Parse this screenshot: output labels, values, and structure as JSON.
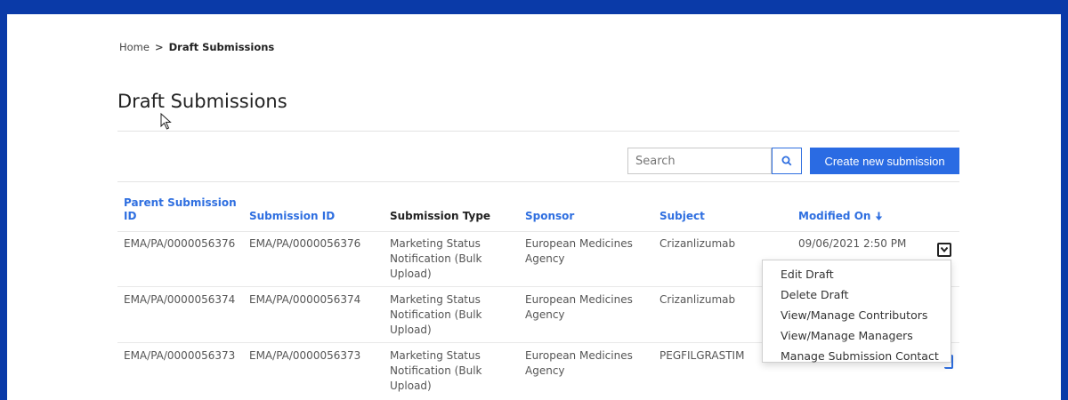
{
  "breadcrumb": {
    "home": "Home",
    "separator": ">",
    "current": "Draft Submissions"
  },
  "page": {
    "title": "Draft Submissions"
  },
  "toolbar": {
    "search_placeholder": "Search",
    "search_icon": "search-icon",
    "create_label": "Create new submission"
  },
  "table": {
    "headers": {
      "parent_id": "Parent Submission ID",
      "submission_id": "Submission ID",
      "type": "Submission Type",
      "sponsor": "Sponsor",
      "subject": "Subject",
      "modified": "Modified On"
    },
    "sort_icon": "arrow-down-icon",
    "rows": [
      {
        "parent_id": "EMA/PA/0000056376",
        "submission_id": "EMA/PA/0000056376",
        "type": "Marketing Status Notification (Bulk Upload)",
        "sponsor": "European Medicines Agency",
        "subject": "Crizanlizumab",
        "modified": "09/06/2021 2:50 PM"
      },
      {
        "parent_id": "EMA/PA/0000056374",
        "submission_id": "EMA/PA/0000056374",
        "type": "Marketing Status Notification (Bulk Upload)",
        "sponsor": "European Medicines Agency",
        "subject": "Crizanlizumab",
        "modified": ""
      },
      {
        "parent_id": "EMA/PA/0000056373",
        "submission_id": "EMA/PA/0000056373",
        "type": "Marketing Status Notification (Bulk Upload)",
        "sponsor": "European Medicines Agency",
        "subject": "PEGFILGRASTIM",
        "modified": ""
      }
    ]
  },
  "row_menu": {
    "items": [
      "Edit Draft",
      "Delete Draft",
      "View/Manage Contributors",
      "View/Manage Managers",
      "Manage Submission Contact"
    ]
  },
  "colors": {
    "brand_blue": "#0a3aa8",
    "accent": "#2a6be3",
    "link": "#2f6fe0"
  }
}
